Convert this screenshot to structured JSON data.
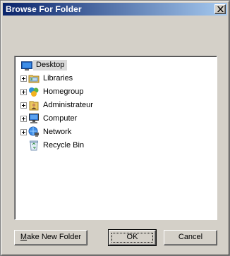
{
  "window": {
    "title": "Browse For Folder"
  },
  "tree": {
    "root": {
      "label": "Desktop",
      "icon": "desktop-icon"
    },
    "items": [
      {
        "label": "Libraries",
        "icon": "libraries-icon",
        "expandable": true
      },
      {
        "label": "Homegroup",
        "icon": "homegroup-icon",
        "expandable": true
      },
      {
        "label": "Administrateur",
        "icon": "user-folder-icon",
        "expandable": true
      },
      {
        "label": "Computer",
        "icon": "computer-icon",
        "expandable": true
      },
      {
        "label": "Network",
        "icon": "network-icon",
        "expandable": true
      },
      {
        "label": "Recycle Bin",
        "icon": "recycle-bin-icon",
        "expandable": false
      }
    ]
  },
  "buttons": {
    "new_folder_mnemonic": "M",
    "new_folder_rest": "ake New Folder",
    "ok": "OK",
    "cancel": "Cancel"
  },
  "colors": {
    "title_gradient_start": "#0a246a",
    "title_gradient_end": "#a6caf0",
    "dialog_bg": "#d4d0c8",
    "selection_bg": "#d9d9d9"
  }
}
